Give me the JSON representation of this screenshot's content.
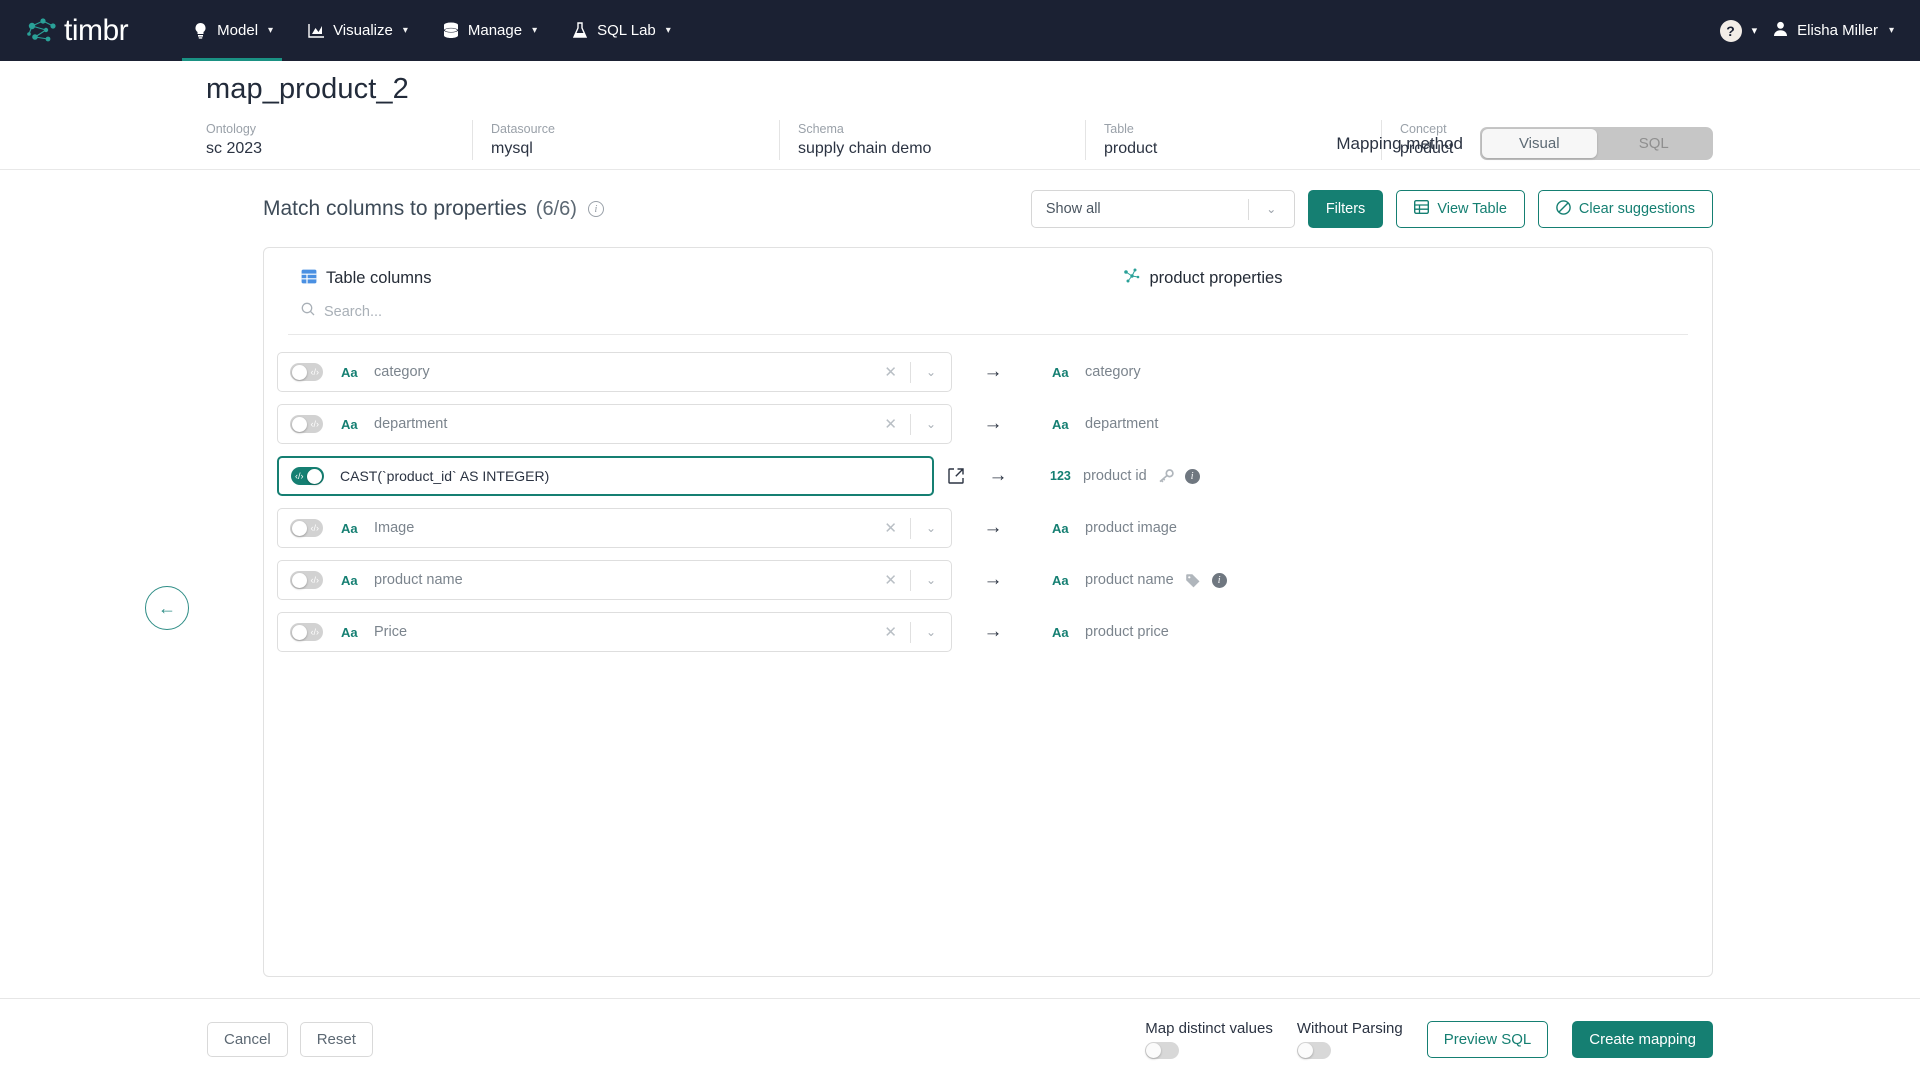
{
  "navbar": {
    "logo_text": "timbr",
    "items": [
      {
        "label": "Model",
        "icon": "bulb-icon",
        "active": true
      },
      {
        "label": "Visualize",
        "icon": "chart-icon",
        "active": false
      },
      {
        "label": "Manage",
        "icon": "database-icon",
        "active": false
      },
      {
        "label": "SQL Lab",
        "icon": "flask-icon",
        "active": false
      }
    ],
    "help_label": "?",
    "user_name": "Elisha Miller"
  },
  "header": {
    "title": "map_product_2",
    "meta": [
      {
        "key": "Ontology",
        "value": "sc 2023"
      },
      {
        "key": "Datasource",
        "value": "mysql"
      },
      {
        "key": "Schema",
        "value": "supply chain demo"
      },
      {
        "key": "Table",
        "value": "product"
      },
      {
        "key": "Concept",
        "value": "product"
      }
    ],
    "mapping_method_label": "Mapping method",
    "mapping_options": [
      {
        "label": "Visual",
        "selected": true
      },
      {
        "label": "SQL",
        "selected": false
      }
    ]
  },
  "toolbar": {
    "title": "Match columns to properties",
    "count": "(6/6)",
    "select_value": "Show all",
    "filters_label": "Filters",
    "view_table_label": "View Table",
    "clear_suggestions_label": "Clear suggestions"
  },
  "panels": {
    "left_title": "Table columns",
    "right_title": "product properties",
    "search_placeholder": "Search..."
  },
  "rows": [
    {
      "toggle_on": false,
      "type": "Aa",
      "column": "category",
      "expression": false,
      "arrow": "→",
      "prop_type": "Aa",
      "prop": "category",
      "badges": []
    },
    {
      "toggle_on": false,
      "type": "Aa",
      "column": "department",
      "expression": false,
      "arrow": "→",
      "prop_type": "Aa",
      "prop": "department",
      "badges": []
    },
    {
      "toggle_on": true,
      "type": "",
      "column": "CAST(`product_id` AS INTEGER)",
      "expression": true,
      "arrow": "→",
      "prop_type": "123",
      "prop": "product id",
      "badges": [
        "key-icon",
        "info-icon"
      ]
    },
    {
      "toggle_on": false,
      "type": "Aa",
      "column": "Image",
      "expression": false,
      "arrow": "→",
      "prop_type": "Aa",
      "prop": "product image",
      "badges": []
    },
    {
      "toggle_on": false,
      "type": "Aa",
      "column": "product name",
      "expression": false,
      "arrow": "→",
      "prop_type": "Aa",
      "prop": "product name",
      "badges": [
        "tag-icon",
        "info-icon"
      ]
    },
    {
      "toggle_on": false,
      "type": "Aa",
      "column": "Price",
      "expression": false,
      "arrow": "→",
      "prop_type": "Aa",
      "prop": "product price",
      "badges": []
    }
  ],
  "footer": {
    "cancel_label": "Cancel",
    "reset_label": "Reset",
    "map_distinct_label": "Map distinct values",
    "map_distinct_on": false,
    "without_parsing_label": "Without Parsing",
    "without_parsing_on": false,
    "preview_sql_label": "Preview SQL",
    "create_mapping_label": "Create mapping"
  },
  "colors": {
    "navbar_bg": "#1b2133",
    "accent_teal": "#157f72",
    "active_underline": "#1a9183",
    "table_icon_blue": "#4a90e2"
  }
}
